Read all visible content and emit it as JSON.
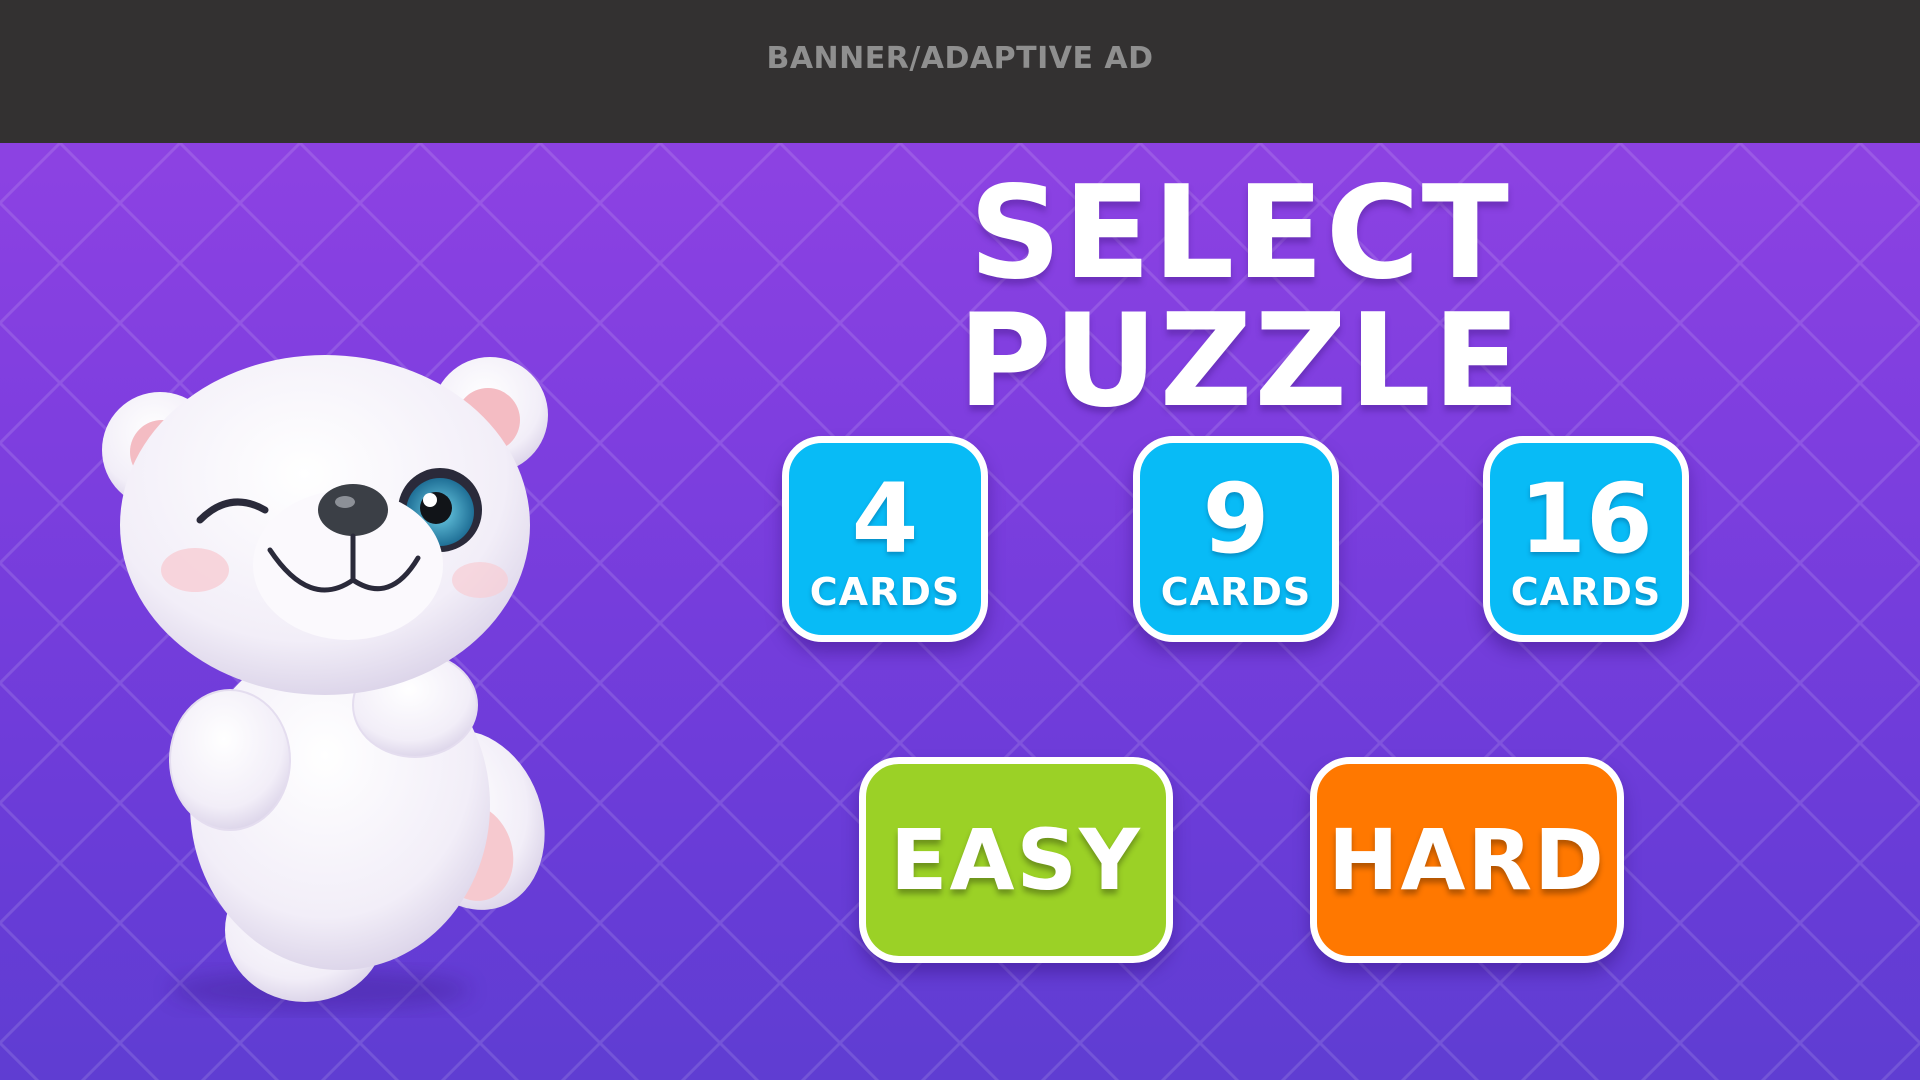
{
  "ad": {
    "label": "BANNER/ADAPTIVE AD"
  },
  "title": "SELECT PUZZLE",
  "mascot": {
    "icon": "polar-bear-mascot"
  },
  "card_options": [
    {
      "count": "4",
      "label": "CARDS"
    },
    {
      "count": "9",
      "label": "CARDS"
    },
    {
      "count": "16",
      "label": "CARDS"
    }
  ],
  "difficulty": {
    "easy_label": "EASY",
    "hard_label": "HARD"
  },
  "colors": {
    "background_top": "#9444e4",
    "background_bottom": "#5f3dd2",
    "ad_bar": "#333131",
    "card_button": "#08bbf6",
    "easy_button": "#9bd126",
    "hard_button": "#ff7800",
    "button_border": "#ffffff"
  }
}
